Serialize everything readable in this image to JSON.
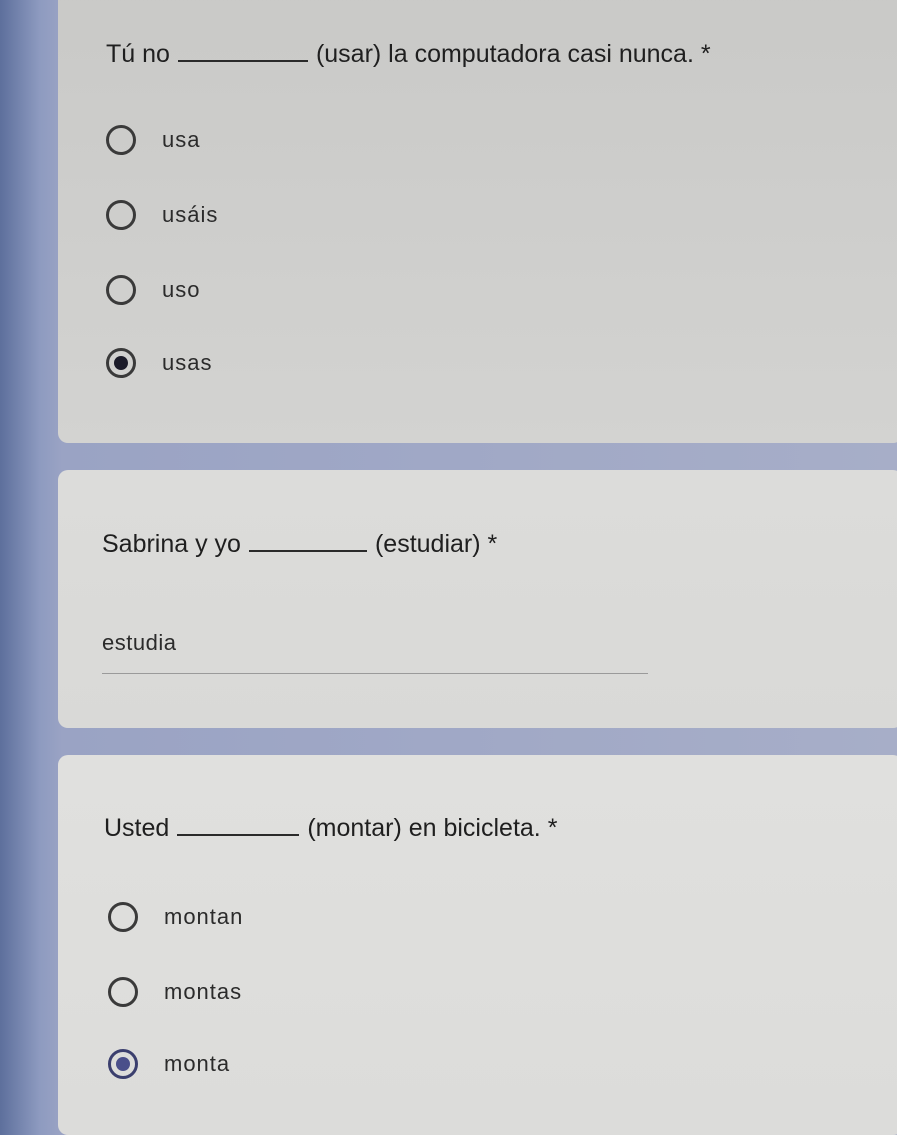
{
  "questions": [
    {
      "before": "Tú no",
      "after": "(usar) la computadora casi nunca.",
      "required_mark": "*",
      "options": [
        "usa",
        "usáis",
        "uso",
        "usas"
      ],
      "selected": "usas"
    },
    {
      "before": "Sabrina y yo",
      "after": "(estudiar)",
      "required_mark": "*",
      "answer": "estudia"
    },
    {
      "before": "Usted",
      "after": "(montar) en bicicleta.",
      "required_mark": "*",
      "options": [
        "montan",
        "montas",
        "monta"
      ],
      "selected": "monta"
    }
  ]
}
